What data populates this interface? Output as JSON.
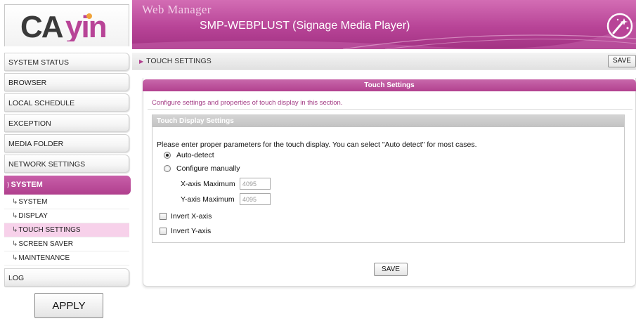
{
  "header": {
    "logo_text": "CAYIN",
    "title": "Web Manager",
    "subtitle": "SMP-WEBPLUST (Signage Media Player)",
    "brand_color": "#b84497"
  },
  "sidebar": {
    "items": [
      {
        "label": "SYSTEM STATUS"
      },
      {
        "label": "BROWSER"
      },
      {
        "label": "LOCAL SCHEDULE"
      },
      {
        "label": "EXCEPTION"
      },
      {
        "label": "MEDIA FOLDER"
      },
      {
        "label": "NETWORK SETTINGS"
      }
    ],
    "active_section": "SYSTEM",
    "sub_items": [
      {
        "label": "SYSTEM"
      },
      {
        "label": "DISPLAY"
      },
      {
        "label": "TOUCH SETTINGS"
      },
      {
        "label": "SCREEN SAVER"
      },
      {
        "label": "MAINTENANCE"
      }
    ],
    "last_item": "LOG",
    "apply_label": "APPLY"
  },
  "toolbar": {
    "breadcrumb": "TOUCH SETTINGS",
    "save_label": "SAVE"
  },
  "panel": {
    "title": "Touch Settings",
    "description": "Configure settings and properties of touch display in this section.",
    "group_title": "Touch Display Settings",
    "instructions": "Please enter proper parameters for the touch display. You can select \"Auto detect\" for most cases.",
    "mode_options": [
      {
        "label": "Auto-detect",
        "selected": true
      },
      {
        "label": "Configure manually",
        "selected": false
      }
    ],
    "x_axis": {
      "label": "X-axis Maximum",
      "value": "4095"
    },
    "y_axis": {
      "label": "Y-axis Maximum",
      "value": "4095"
    },
    "invert_x": {
      "label": "Invert X-axis",
      "checked": false
    },
    "invert_y": {
      "label": "Invert Y-axis",
      "checked": false
    },
    "save_label": "SAVE"
  }
}
